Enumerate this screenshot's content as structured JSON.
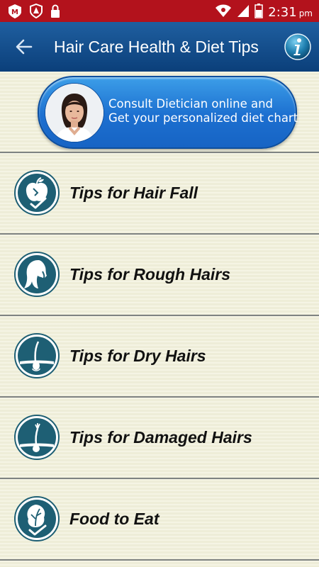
{
  "status_bar": {
    "time": "2:31",
    "ampm": "pm"
  },
  "app_bar": {
    "title": "Hair Care Health & Diet Tips",
    "back_icon": "arrow-left-icon",
    "info_icon": "info-icon"
  },
  "banner": {
    "line1": "Consult Dietician online and",
    "line2": "Get your personalized diet chart"
  },
  "list": [
    {
      "label": "Tips for Hair Fall",
      "icon": "apple-check-icon"
    },
    {
      "label": "Tips for Rough Hairs",
      "icon": "hair-head-icon"
    },
    {
      "label": "Tips for Dry Hairs",
      "icon": "hair-follicle-icon"
    },
    {
      "label": "Tips for Damaged Hairs",
      "icon": "damaged-follicle-icon"
    },
    {
      "label": "Food to Eat",
      "icon": "leaf-check-icon"
    }
  ],
  "colors": {
    "status_bar": "#b3121c",
    "app_bar": "#0b3f7a",
    "background": "#f2f1db",
    "icon_teal": "#1e5f74"
  }
}
